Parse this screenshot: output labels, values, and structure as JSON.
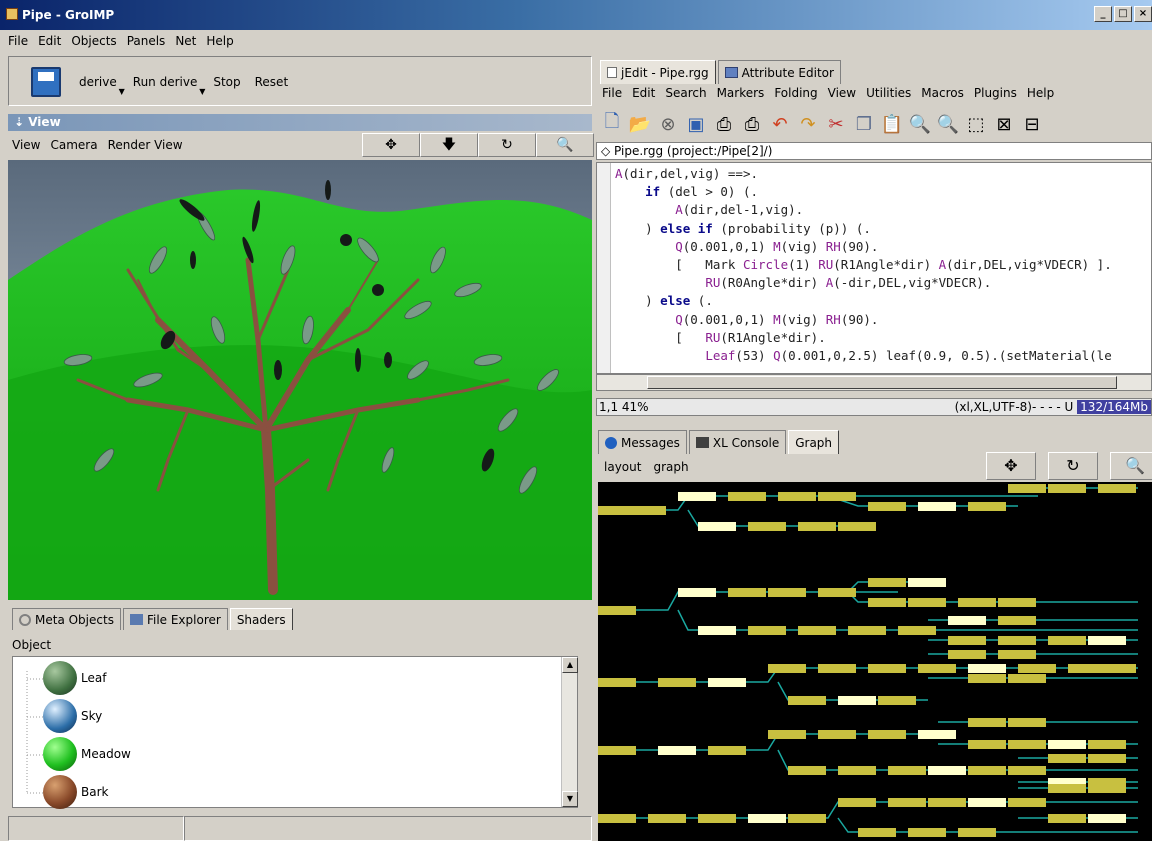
{
  "window": {
    "title": "Pipe - GroIMP",
    "btn_min": "_",
    "btn_max": "□",
    "btn_close": "×"
  },
  "menubar": [
    "File",
    "Edit",
    "Objects",
    "Panels",
    "Net",
    "Help"
  ],
  "toolbar": {
    "derive": "derive",
    "run_derive": "Run derive",
    "stop": "Stop",
    "reset": "Reset"
  },
  "view": {
    "header": "View",
    "menu": [
      "View",
      "Camera",
      "Render View"
    ]
  },
  "left_tabs": [
    "Meta Objects",
    "File Explorer",
    "Shaders"
  ],
  "object_label": "Object",
  "shaders": [
    {
      "name": "Leaf",
      "color": "#3f7040"
    },
    {
      "name": "Sky",
      "color": "#2c6ea8"
    },
    {
      "name": "Meadow",
      "color": "#20c020"
    },
    {
      "name": "Bark",
      "color": "#8a4a2a"
    }
  ],
  "editor": {
    "tabs": [
      "jEdit - Pipe.rgg",
      "Attribute Editor"
    ],
    "menu": [
      "File",
      "Edit",
      "Search",
      "Markers",
      "Folding",
      "View",
      "Utilities",
      "Macros",
      "Plugins",
      "Help"
    ],
    "file_path": "◇ Pipe.rgg (project:/Pipe[2]/)",
    "status_left": "1,1 41%",
    "status_right": "(xl,XL,UTF-8)- - - - U",
    "memory": "132/164Mb"
  },
  "graph_panel": {
    "tabs": [
      "Messages",
      "XL Console",
      "Graph"
    ],
    "menu": [
      "layout",
      "graph"
    ]
  }
}
